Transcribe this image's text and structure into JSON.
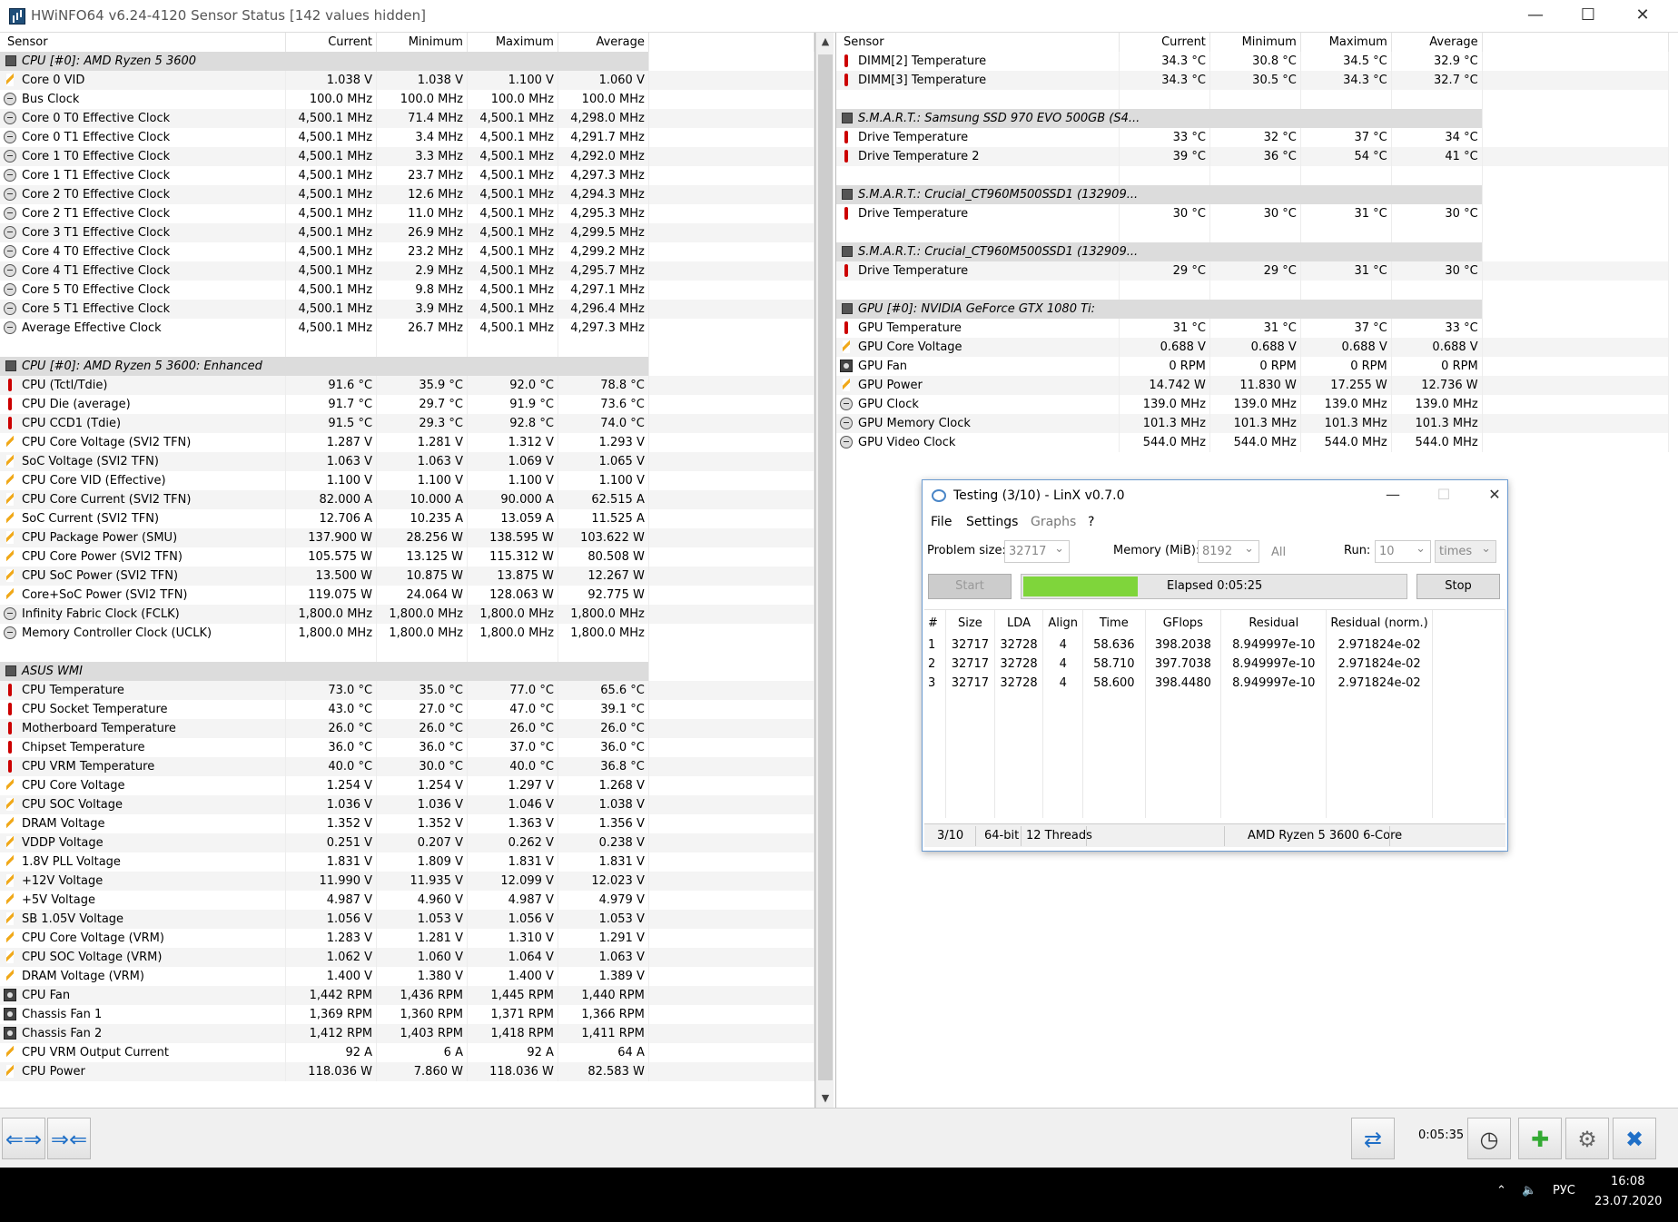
{
  "window": {
    "title": "HWiNFO64 v6.24-4120 Sensor Status [142 values hidden]",
    "minimize": "—",
    "maximize": "☐",
    "close": "✕"
  },
  "left_panel": {
    "headers": [
      "Sensor",
      "Current",
      "Minimum",
      "Maximum",
      "Average"
    ],
    "rows": [
      {
        "t": "group",
        "name": "CPU [#0]: AMD Ryzen 5 3600"
      },
      {
        "t": "volt",
        "name": "Core 0 VID",
        "v": [
          "1.038 V",
          "1.038 V",
          "1.100 V",
          "1.060 V"
        ]
      },
      {
        "t": "clock",
        "name": "Bus Clock",
        "v": [
          "100.0 MHz",
          "100.0 MHz",
          "100.0 MHz",
          "100.0 MHz"
        ]
      },
      {
        "t": "clock",
        "name": "Core 0 T0 Effective Clock",
        "v": [
          "4,500.1 MHz",
          "71.4 MHz",
          "4,500.1 MHz",
          "4,298.0 MHz"
        ]
      },
      {
        "t": "clock",
        "name": "Core 0 T1 Effective Clock",
        "v": [
          "4,500.1 MHz",
          "3.4 MHz",
          "4,500.1 MHz",
          "4,291.7 MHz"
        ]
      },
      {
        "t": "clock",
        "name": "Core 1 T0 Effective Clock",
        "v": [
          "4,500.1 MHz",
          "3.3 MHz",
          "4,500.1 MHz",
          "4,292.0 MHz"
        ]
      },
      {
        "t": "clock",
        "name": "Core 1 T1 Effective Clock",
        "v": [
          "4,500.1 MHz",
          "23.7 MHz",
          "4,500.1 MHz",
          "4,297.3 MHz"
        ]
      },
      {
        "t": "clock",
        "name": "Core 2 T0 Effective Clock",
        "v": [
          "4,500.1 MHz",
          "12.6 MHz",
          "4,500.1 MHz",
          "4,294.3 MHz"
        ]
      },
      {
        "t": "clock",
        "name": "Core 2 T1 Effective Clock",
        "v": [
          "4,500.1 MHz",
          "11.0 MHz",
          "4,500.1 MHz",
          "4,295.3 MHz"
        ]
      },
      {
        "t": "clock",
        "name": "Core 3 T1 Effective Clock",
        "v": [
          "4,500.1 MHz",
          "26.9 MHz",
          "4,500.1 MHz",
          "4,299.5 MHz"
        ]
      },
      {
        "t": "clock",
        "name": "Core 4 T0 Effective Clock",
        "v": [
          "4,500.1 MHz",
          "23.2 MHz",
          "4,500.1 MHz",
          "4,299.2 MHz"
        ]
      },
      {
        "t": "clock",
        "name": "Core 4 T1 Effective Clock",
        "v": [
          "4,500.1 MHz",
          "2.9 MHz",
          "4,500.1 MHz",
          "4,295.7 MHz"
        ]
      },
      {
        "t": "clock",
        "name": "Core 5 T0 Effective Clock",
        "v": [
          "4,500.1 MHz",
          "9.8 MHz",
          "4,500.1 MHz",
          "4,297.1 MHz"
        ]
      },
      {
        "t": "clock",
        "name": "Core 5 T1 Effective Clock",
        "v": [
          "4,500.1 MHz",
          "3.9 MHz",
          "4,500.1 MHz",
          "4,296.4 MHz"
        ]
      },
      {
        "t": "clock",
        "name": "Average Effective Clock",
        "v": [
          "4,500.1 MHz",
          "26.7 MHz",
          "4,500.1 MHz",
          "4,297.3 MHz"
        ]
      },
      {
        "t": "blank"
      },
      {
        "t": "group",
        "name": "CPU [#0]: AMD Ryzen 5 3600: Enhanced"
      },
      {
        "t": "temp",
        "name": "CPU (Tctl/Tdie)",
        "v": [
          "91.6 °C",
          "35.9 °C",
          "92.0 °C",
          "78.8 °C"
        ]
      },
      {
        "t": "temp",
        "name": "CPU Die (average)",
        "v": [
          "91.7 °C",
          "29.7 °C",
          "91.9 °C",
          "73.6 °C"
        ]
      },
      {
        "t": "temp",
        "name": "CPU CCD1 (Tdie)",
        "v": [
          "91.5 °C",
          "29.3 °C",
          "92.8 °C",
          "74.0 °C"
        ]
      },
      {
        "t": "volt",
        "name": "CPU Core Voltage (SVI2 TFN)",
        "v": [
          "1.287 V",
          "1.281 V",
          "1.312 V",
          "1.293 V"
        ]
      },
      {
        "t": "volt",
        "name": "SoC Voltage (SVI2 TFN)",
        "v": [
          "1.063 V",
          "1.063 V",
          "1.069 V",
          "1.065 V"
        ]
      },
      {
        "t": "volt",
        "name": "CPU Core VID (Effective)",
        "v": [
          "1.100 V",
          "1.100 V",
          "1.100 V",
          "1.100 V"
        ]
      },
      {
        "t": "volt",
        "name": "CPU Core Current (SVI2 TFN)",
        "v": [
          "82.000 A",
          "10.000 A",
          "90.000 A",
          "62.515 A"
        ]
      },
      {
        "t": "volt",
        "name": "SoC Current (SVI2 TFN)",
        "v": [
          "12.706 A",
          "10.235 A",
          "13.059 A",
          "11.525 A"
        ]
      },
      {
        "t": "volt",
        "name": "CPU Package Power (SMU)",
        "v": [
          "137.900 W",
          "28.256 W",
          "138.595 W",
          "103.622 W"
        ]
      },
      {
        "t": "volt",
        "name": "CPU Core Power (SVI2 TFN)",
        "v": [
          "105.575 W",
          "13.125 W",
          "115.312 W",
          "80.508 W"
        ]
      },
      {
        "t": "volt",
        "name": "CPU SoC Power (SVI2 TFN)",
        "v": [
          "13.500 W",
          "10.875 W",
          "13.875 W",
          "12.267 W"
        ]
      },
      {
        "t": "volt",
        "name": "Core+SoC Power (SVI2 TFN)",
        "v": [
          "119.075 W",
          "24.064 W",
          "128.063 W",
          "92.775 W"
        ]
      },
      {
        "t": "clock",
        "name": "Infinity Fabric Clock (FCLK)",
        "v": [
          "1,800.0 MHz",
          "1,800.0 MHz",
          "1,800.0 MHz",
          "1,800.0 MHz"
        ]
      },
      {
        "t": "clock",
        "name": "Memory Controller Clock (UCLK)",
        "v": [
          "1,800.0 MHz",
          "1,800.0 MHz",
          "1,800.0 MHz",
          "1,800.0 MHz"
        ]
      },
      {
        "t": "blank"
      },
      {
        "t": "group",
        "name": "ASUS WMI"
      },
      {
        "t": "temp",
        "name": "CPU Temperature",
        "v": [
          "73.0 °C",
          "35.0 °C",
          "77.0 °C",
          "65.6 °C"
        ]
      },
      {
        "t": "temp",
        "name": "CPU Socket Temperature",
        "v": [
          "43.0 °C",
          "27.0 °C",
          "47.0 °C",
          "39.1 °C"
        ]
      },
      {
        "t": "temp",
        "name": "Motherboard Temperature",
        "v": [
          "26.0 °C",
          "26.0 °C",
          "26.0 °C",
          "26.0 °C"
        ]
      },
      {
        "t": "temp",
        "name": "Chipset Temperature",
        "v": [
          "36.0 °C",
          "36.0 °C",
          "37.0 °C",
          "36.0 °C"
        ]
      },
      {
        "t": "temp",
        "name": "CPU VRM Temperature",
        "v": [
          "40.0 °C",
          "30.0 °C",
          "40.0 °C",
          "36.8 °C"
        ]
      },
      {
        "t": "volt",
        "name": "CPU Core Voltage",
        "v": [
          "1.254 V",
          "1.254 V",
          "1.297 V",
          "1.268 V"
        ]
      },
      {
        "t": "volt",
        "name": "CPU SOC Voltage",
        "v": [
          "1.036 V",
          "1.036 V",
          "1.046 V",
          "1.038 V"
        ]
      },
      {
        "t": "volt",
        "name": "DRAM Voltage",
        "v": [
          "1.352 V",
          "1.352 V",
          "1.363 V",
          "1.356 V"
        ]
      },
      {
        "t": "volt",
        "name": "VDDP Voltage",
        "v": [
          "0.251 V",
          "0.207 V",
          "0.262 V",
          "0.238 V"
        ]
      },
      {
        "t": "volt",
        "name": "1.8V PLL Voltage",
        "v": [
          "1.831 V",
          "1.809 V",
          "1.831 V",
          "1.831 V"
        ]
      },
      {
        "t": "volt",
        "name": "+12V Voltage",
        "v": [
          "11.990 V",
          "11.935 V",
          "12.099 V",
          "12.023 V"
        ]
      },
      {
        "t": "volt",
        "name": "+5V Voltage",
        "v": [
          "4.987 V",
          "4.960 V",
          "4.987 V",
          "4.979 V"
        ]
      },
      {
        "t": "volt",
        "name": "SB 1.05V Voltage",
        "v": [
          "1.056 V",
          "1.053 V",
          "1.056 V",
          "1.053 V"
        ]
      },
      {
        "t": "volt",
        "name": "CPU Core Voltage (VRM)",
        "v": [
          "1.283 V",
          "1.281 V",
          "1.310 V",
          "1.291 V"
        ]
      },
      {
        "t": "volt",
        "name": "CPU SOC Voltage (VRM)",
        "v": [
          "1.062 V",
          "1.060 V",
          "1.064 V",
          "1.063 V"
        ]
      },
      {
        "t": "volt",
        "name": "DRAM Voltage (VRM)",
        "v": [
          "1.400 V",
          "1.380 V",
          "1.400 V",
          "1.389 V"
        ]
      },
      {
        "t": "fan",
        "name": "CPU Fan",
        "v": [
          "1,442 RPM",
          "1,436 RPM",
          "1,445 RPM",
          "1,440 RPM"
        ]
      },
      {
        "t": "fan",
        "name": "Chassis Fan 1",
        "v": [
          "1,369 RPM",
          "1,360 RPM",
          "1,371 RPM",
          "1,366 RPM"
        ]
      },
      {
        "t": "fan",
        "name": "Chassis Fan 2",
        "v": [
          "1,412 RPM",
          "1,403 RPM",
          "1,418 RPM",
          "1,411 RPM"
        ]
      },
      {
        "t": "volt",
        "name": "CPU VRM Output Current",
        "v": [
          "92 A",
          "6 A",
          "92 A",
          "64 A"
        ]
      },
      {
        "t": "volt",
        "name": "CPU Power",
        "v": [
          "118.036 W",
          "7.860 W",
          "118.036 W",
          "82.583 W"
        ]
      }
    ]
  },
  "right_panel": {
    "headers": [
      "Sensor",
      "Current",
      "Minimum",
      "Maximum",
      "Average"
    ],
    "rows": [
      {
        "t": "temp",
        "name": "DIMM[2] Temperature",
        "v": [
          "34.3 °C",
          "30.8 °C",
          "34.5 °C",
          "32.9 °C"
        ]
      },
      {
        "t": "temp",
        "name": "DIMM[3] Temperature",
        "v": [
          "34.3 °C",
          "30.5 °C",
          "34.3 °C",
          "32.7 °C"
        ]
      },
      {
        "t": "blank"
      },
      {
        "t": "group",
        "name": "S.M.A.R.T.: Samsung SSD 970 EVO 500GB (S4..."
      },
      {
        "t": "temp",
        "name": "Drive Temperature",
        "v": [
          "33 °C",
          "32 °C",
          "37 °C",
          "34 °C"
        ]
      },
      {
        "t": "temp",
        "name": "Drive Temperature 2",
        "v": [
          "39 °C",
          "36 °C",
          "54 °C",
          "41 °C"
        ]
      },
      {
        "t": "blank"
      },
      {
        "t": "group",
        "name": "S.M.A.R.T.: Crucial_CT960M500SSD1 (132909..."
      },
      {
        "t": "temp",
        "name": "Drive Temperature",
        "v": [
          "30 °C",
          "30 °C",
          "31 °C",
          "30 °C"
        ]
      },
      {
        "t": "blank"
      },
      {
        "t": "group",
        "name": "S.M.A.R.T.: Crucial_CT960M500SSD1 (132909..."
      },
      {
        "t": "temp",
        "name": "Drive Temperature",
        "v": [
          "29 °C",
          "29 °C",
          "31 °C",
          "30 °C"
        ]
      },
      {
        "t": "blank"
      },
      {
        "t": "group",
        "name": "GPU [#0]: NVIDIA GeForce GTX 1080 Ti:"
      },
      {
        "t": "temp",
        "name": "GPU Temperature",
        "v": [
          "31 °C",
          "31 °C",
          "37 °C",
          "33 °C"
        ]
      },
      {
        "t": "volt",
        "name": "GPU Core Voltage",
        "v": [
          "0.688 V",
          "0.688 V",
          "0.688 V",
          "0.688 V"
        ]
      },
      {
        "t": "fan",
        "name": "GPU Fan",
        "v": [
          "0 RPM",
          "0 RPM",
          "0 RPM",
          "0 RPM"
        ]
      },
      {
        "t": "volt",
        "name": "GPU Power",
        "v": [
          "14.742 W",
          "11.830 W",
          "17.255 W",
          "12.736 W"
        ]
      },
      {
        "t": "clock",
        "name": "GPU Clock",
        "v": [
          "139.0 MHz",
          "139.0 MHz",
          "139.0 MHz",
          "139.0 MHz"
        ]
      },
      {
        "t": "clock",
        "name": "GPU Memory Clock",
        "v": [
          "101.3 MHz",
          "101.3 MHz",
          "101.3 MHz",
          "101.3 MHz"
        ]
      },
      {
        "t": "clock",
        "name": "GPU Video Clock",
        "v": [
          "544.0 MHz",
          "544.0 MHz",
          "544.0 MHz",
          "544.0 MHz"
        ]
      }
    ]
  },
  "linx": {
    "title": "Testing (3/10) - LinX v0.7.0",
    "menu": {
      "file": "File",
      "settings": "Settings",
      "graphs": "Graphs",
      "help": "?"
    },
    "problem_size_label": "Problem size:",
    "problem_size": "32717",
    "memory_label": "Memory (MiB):",
    "memory": "8192",
    "all_label": "All",
    "run_label": "Run:",
    "run": "10",
    "run_unit": "times",
    "start_label": "Start",
    "stop_label": "Stop",
    "progress_text": "Elapsed 0:05:25",
    "progress_fraction": 0.3,
    "table_headers": [
      "#",
      "Size",
      "LDA",
      "Align",
      "Time",
      "GFlops",
      "Residual",
      "Residual (norm.)"
    ],
    "table_rows": [
      [
        "1",
        "32717",
        "32728",
        "4",
        "58.636",
        "398.2038",
        "8.949997e-10",
        "2.971824e-02"
      ],
      [
        "2",
        "32717",
        "32728",
        "4",
        "58.710",
        "397.7038",
        "8.949997e-10",
        "2.971824e-02"
      ],
      [
        "3",
        "32717",
        "32728",
        "4",
        "58.600",
        "398.4480",
        "8.949997e-10",
        "2.971824e-02"
      ]
    ],
    "status": {
      "run": "3/10",
      "bits": "64-bit",
      "threads": "12 Threads",
      "cpu": "AMD Ryzen 5 3600 6-Core"
    }
  },
  "bottombar": {
    "elapsed": "0:05:35"
  },
  "taskbar": {
    "lang": "РУС",
    "time": "16:08",
    "date": "23.07.2020",
    "tray_arrow": "⌃",
    "volume": "🔈"
  },
  "icons": {
    "volt": "lightning-icon",
    "temp": "thermometer-icon",
    "clock": "clock-icon",
    "fan": "fan-icon",
    "group": "chip-icon"
  }
}
